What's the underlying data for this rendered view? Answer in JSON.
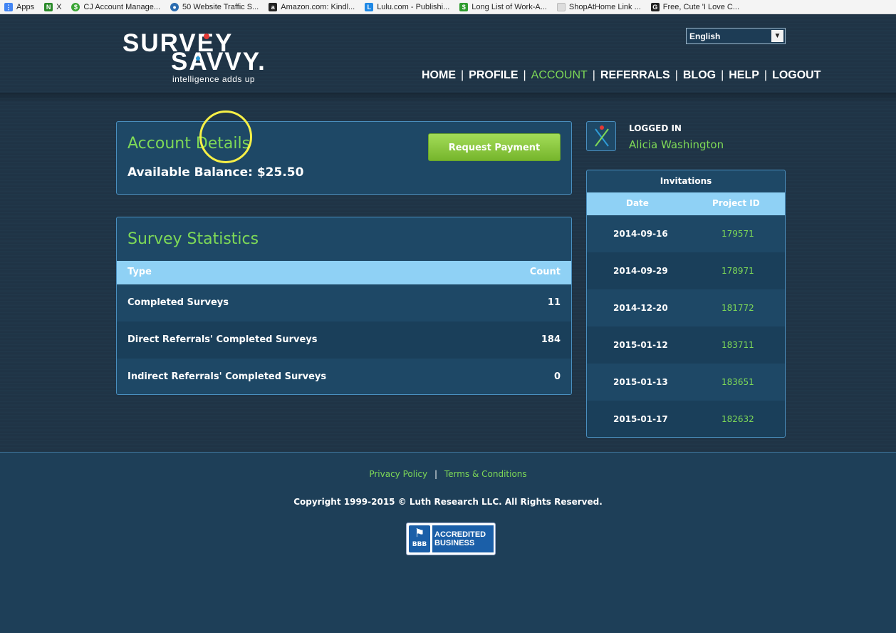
{
  "bookmarks": [
    {
      "label": "Apps",
      "icon": "apps-grid-icon",
      "color": "#4285f4"
    },
    {
      "label": "X",
      "icon": "n-bookmark-icon",
      "color": "#2a8a2a"
    },
    {
      "label": "CJ Account Manage...",
      "icon": "cj-icon",
      "color": "#3aa535"
    },
    {
      "label": "50 Website Traffic S...",
      "icon": "globe-icon",
      "color": "#2b6cb0"
    },
    {
      "label": "Amazon.com: Kindl...",
      "icon": "amazon-icon",
      "color": "#222222"
    },
    {
      "label": "Lulu.com - Publishi...",
      "icon": "lulu-icon",
      "color": "#1e88e5"
    },
    {
      "label": "Long List of Work-A...",
      "icon": "dollar-icon",
      "color": "#2e9b2e"
    },
    {
      "label": "ShopAtHome Link ...",
      "icon": "page-icon",
      "color": "#dddddd"
    },
    {
      "label": "Free, Cute 'I Love C...",
      "icon": "g-icon",
      "color": "#222222"
    }
  ],
  "logo": {
    "line1": "SURVEY",
    "line2": "SAVVY.",
    "registered": "®",
    "tagline": "intelligence adds up"
  },
  "language": {
    "selected": "English"
  },
  "nav": {
    "items": [
      "HOME",
      "PROFILE",
      "ACCOUNT",
      "REFERRALS",
      "BLOG",
      "HELP",
      "LOGOUT"
    ],
    "active": "ACCOUNT"
  },
  "account": {
    "title": "Account Details",
    "balance_label": "Available Balance: $25.50",
    "request_button": "Request Payment"
  },
  "stats": {
    "title": "Survey Statistics",
    "col_type": "Type",
    "col_count": "Count",
    "rows": [
      {
        "type": "Completed Surveys",
        "count": "11"
      },
      {
        "type": "Direct Referrals' Completed Surveys",
        "count": "184"
      },
      {
        "type": "Indirect Referrals' Completed Surveys",
        "count": "0"
      }
    ]
  },
  "user": {
    "logged_in_label": "LOGGED IN",
    "name": "Alicia Washington"
  },
  "invitations": {
    "title": "Invitations",
    "col_date": "Date",
    "col_project": "Project ID",
    "rows": [
      {
        "date": "2014-09-16",
        "project_id": "179571"
      },
      {
        "date": "2014-09-29",
        "project_id": "178971"
      },
      {
        "date": "2014-12-20",
        "project_id": "181772"
      },
      {
        "date": "2015-01-12",
        "project_id": "183711"
      },
      {
        "date": "2015-01-13",
        "project_id": "183651"
      },
      {
        "date": "2015-01-17",
        "project_id": "182632"
      }
    ]
  },
  "footer": {
    "privacy": "Privacy Policy",
    "separator": "|",
    "terms": "Terms & Conditions",
    "copyright": "Copyright 1999-2015 © Luth Research LLC. All Rights Reserved.",
    "bbb_seal": "BBB",
    "bbb_line1": "ACCREDITED",
    "bbb_line2": "BUSINESS"
  },
  "colors": {
    "accent_green": "#7ed957",
    "table_header": "#8fd1f5",
    "panel_bg": "#1e4866"
  }
}
